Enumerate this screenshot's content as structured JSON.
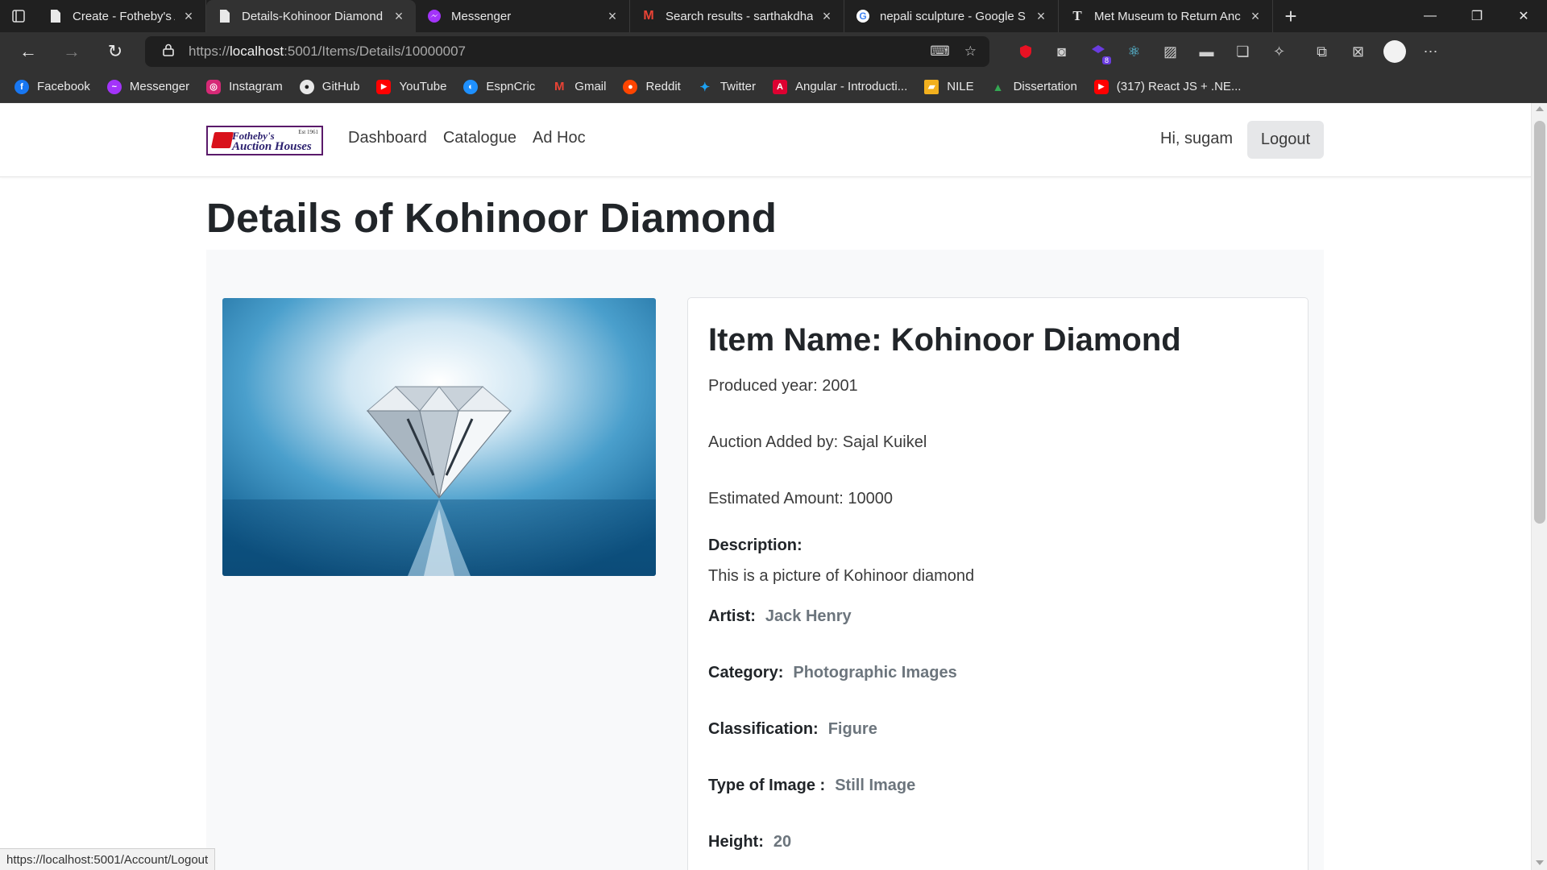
{
  "browser": {
    "tabs": [
      {
        "title": "Create - Fotheby's Auction",
        "icon": "page-icon"
      },
      {
        "title": "Details-Kohinoor Diamond",
        "icon": "page-icon"
      },
      {
        "title": "Messenger",
        "icon": "messenger-icon"
      },
      {
        "title": "Search results - sarthakdhal",
        "icon": "gmail-icon"
      },
      {
        "title": "nepali sculpture - Google S",
        "icon": "google-icon"
      },
      {
        "title": "Met Museum to Return Anc",
        "icon": "nyt-icon"
      }
    ],
    "url_prefix": "https://",
    "url_host": "localhost",
    "url_rest": ":5001/Items/Details/10000007",
    "bookmarks": [
      {
        "label": "Facebook",
        "color": "#1877f2",
        "glyph": "f"
      },
      {
        "label": "Messenger",
        "color": "#a334fa",
        "glyph": "~"
      },
      {
        "label": "Instagram",
        "color": "#d62976",
        "glyph": "◎"
      },
      {
        "label": "GitHub",
        "color": "#e8e8e8",
        "glyph": "●"
      },
      {
        "label": "YouTube",
        "color": "#ff0000",
        "glyph": "▶"
      },
      {
        "label": "EspnCric",
        "color": "#1e90ff",
        "glyph": "◐"
      },
      {
        "label": "Gmail",
        "color": "#ea4335",
        "glyph": "M"
      },
      {
        "label": "Reddit",
        "color": "#ff4500",
        "glyph": "●"
      },
      {
        "label": "Twitter",
        "color": "#1da1f2",
        "glyph": "✦"
      },
      {
        "label": "Angular - Introducti...",
        "color": "#dd0031",
        "glyph": "A"
      },
      {
        "label": "NILE",
        "color": "#f2b01e",
        "glyph": "▰"
      },
      {
        "label": "Dissertation",
        "color": "#34a853",
        "glyph": "▲"
      },
      {
        "label": "(317) React JS + .NE...",
        "color": "#ff0000",
        "glyph": "▶"
      }
    ],
    "extension_badge": "8",
    "status_url": "https://localhost:5001/Account/Logout"
  },
  "navbar": {
    "brand_line1": "Fotheby's",
    "brand_line2": "Auction Houses",
    "brand_est": "Est 1961",
    "links": [
      "Dashboard",
      "Catalogue",
      "Ad Hoc"
    ],
    "greeting": "Hi, sugam",
    "logout_label": "Logout"
  },
  "page": {
    "title": "Details of Kohinoor Diamond",
    "item_name": "Item Name: Kohinoor Diamond",
    "produced_year": "Produced year: 2001",
    "added_by": "Auction Added by: Sajal Kuikel",
    "estimated_amount": "Estimated Amount: 10000",
    "description_label": "Description:",
    "description": "This is a picture of Kohinoor diamond",
    "attributes": [
      {
        "label": "Artist:",
        "value": "Jack Henry"
      },
      {
        "label": "Category:",
        "value": "Photographic Images"
      },
      {
        "label": "Classification:",
        "value": "Figure"
      },
      {
        "label": "Type of Image :",
        "value": "Still Image"
      },
      {
        "label": "Height:",
        "value": "20"
      }
    ]
  },
  "colors": {
    "chrome_dark": "#202020",
    "chrome": "#323232",
    "value_gray": "#6c757d",
    "panel_bg": "#f8f9fa"
  }
}
